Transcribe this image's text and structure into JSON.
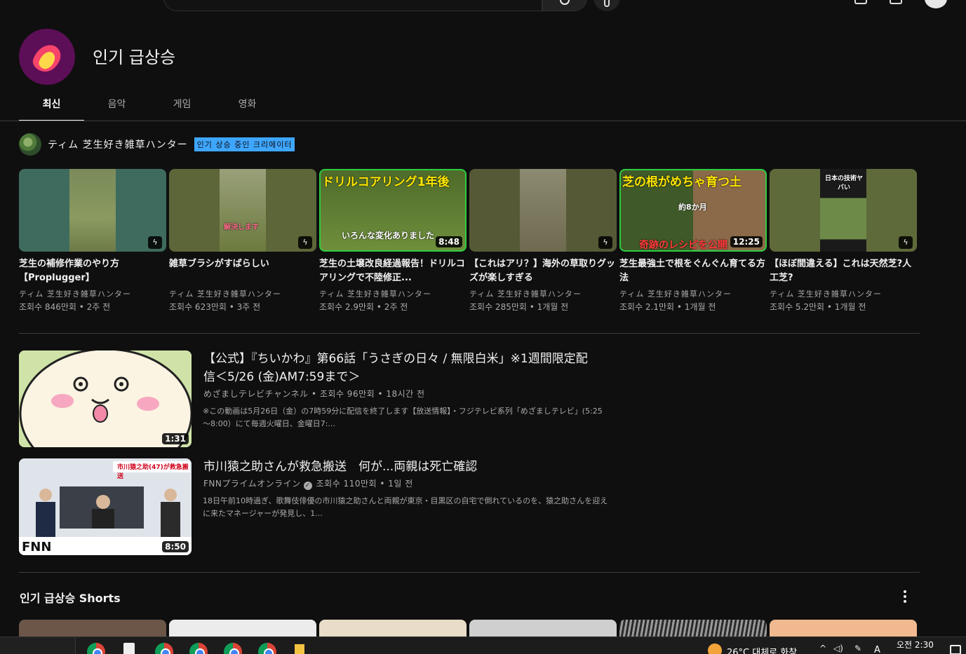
{
  "channel": {
    "title": "인기 급상승"
  },
  "tabs": [
    {
      "label": "최신"
    },
    {
      "label": "음악"
    },
    {
      "label": "게임"
    },
    {
      "label": "영화"
    }
  ],
  "creator": {
    "name": "ティム 芝生好き雑草ハンター",
    "badge": "인기 상승 중인 크리에이터"
  },
  "grid": [
    {
      "title": "芝生の補修作業のやり方【Proplugger】",
      "channel": "ティム 芝生好き雑草ハンター",
      "meta": "조회수 846만회 • 2주 전",
      "short": true,
      "thumb_text": ""
    },
    {
      "title": "雑草ブラシがすばらしい",
      "channel": "ティム 芝生好き雑草ハンター",
      "meta": "조회수 623만회 • 3주 전",
      "short": true,
      "thumb_text": "解決します"
    },
    {
      "title": "芝生の土壌改良経過報告！ドリルコアリングで不陸修正...",
      "channel": "ティム 芝生好き雑草ハンター",
      "meta": "조회수 2.9만회 • 2주 전",
      "duration": "8:48",
      "thumb_text": "ドリルコアリング1年後",
      "thumb_text2": "いろんな変化ありました"
    },
    {
      "title": "【これはアリ？】海外の草取りグッズが楽しすぎる",
      "channel": "ティム 芝生好き雑草ハンター",
      "meta": "조회수 285만회 • 1개월 전",
      "short": true,
      "thumb_text": ""
    },
    {
      "title": "芝生最強土で根をぐんぐん育てる方法",
      "channel": "ティム 芝生好き雑草ハンター",
      "meta": "조회수 2.1만회 • 1개월 전",
      "duration": "12:25",
      "thumb_text": "芝の根がめちゃ育つ土",
      "thumb_text2": "奇跡のレシピを公開",
      "thumb_text3": "約8か月"
    },
    {
      "title": "【ほぼ間違える】これは天然芝?人工芝?",
      "channel": "ティム 芝生好き雑草ハンター",
      "meta": "조회수 5.2만회 • 1개월 전",
      "short": true,
      "thumb_text": "日本の技術ヤバい"
    }
  ],
  "list": [
    {
      "title": "【公式】『ちいかわ』第66話「うさぎの日々 / 無限白米」※1週間限定配信＜5/26 (金)AM7:59まで＞",
      "channel": "めざましテレビチャンネル",
      "meta": "조회수 96만회 • 18시간 전",
      "desc": "※この動画は5月26日（金）の7時59分に配信を終了します【放送情報】・フジテレビ系列「めざましテレビ」(5:25～8:00）にて毎週火曜日、金曜日7:...",
      "duration": "1:31"
    },
    {
      "title": "市川猿之助さんが救急搬送　何が...両親は死亡確認",
      "channel": "FNNプライムオンライン",
      "meta": "조회수 110만회 • 1일 전",
      "desc": "18日午前10時過ぎ、歌舞伎俳優の市川猿之助さんと両親が東京・目黒区の自宅で倒れているのを、猿之助さんを迎えに来たマネージャーが発見し、1...",
      "duration": "8:50",
      "thumb_banner": "市川猿之助(47)が救急搬送",
      "thumb_logo": "FNN"
    }
  ],
  "shorts": {
    "title": "인기 급상승 Shorts"
  },
  "taskbar": {
    "weather": "26°C  대체로 화창",
    "time": "오전 2:30",
    "ime": "A"
  },
  "colors": {
    "accent": "#3ea6ff",
    "background": "#0f0f0f",
    "channel_logo": "#5c0f57"
  }
}
